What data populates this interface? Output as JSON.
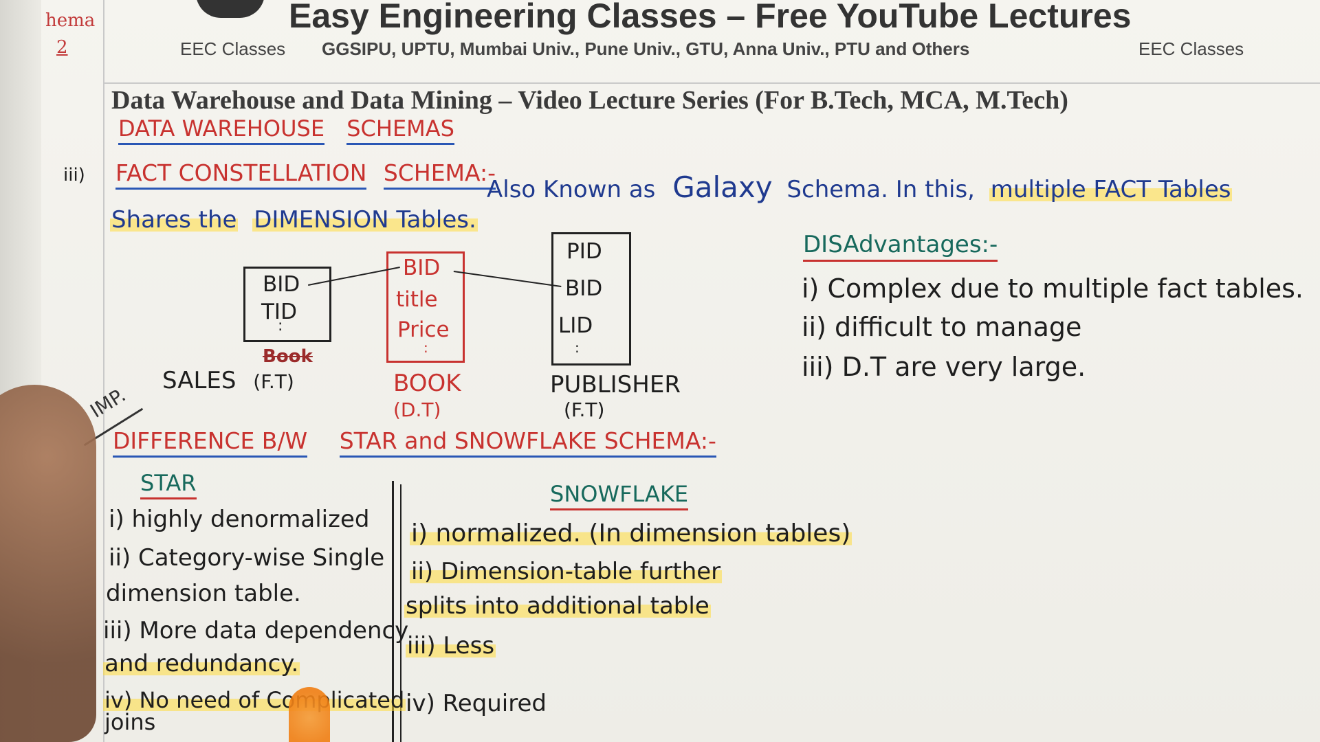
{
  "sidebar": {
    "label": "hema",
    "number": "2"
  },
  "header": {
    "title": "Easy Engineering Classes – Free YouTube Lectures",
    "left_tag": "EEC Classes",
    "universities": "GGSIPU, UPTU, Mumbai Univ., Pune Univ., GTU, Anna Univ., PTU and Others",
    "right_tag": "EEC Classes"
  },
  "series_title": "Data Warehouse and Data Mining – Video Lecture Series (For B.Tech, MCA, M.Tech)",
  "section_heading": {
    "word1": "DATA WAREHOUSE",
    "word2": "SCHEMAS"
  },
  "fact_constellation": {
    "roman": "iii)",
    "heading_a": "FACT CONSTELLATION",
    "heading_b": "SCHEMA:-",
    "line1_a": "Also Known as",
    "line1_b": "Galaxy",
    "line1_c": "Schema. In this,",
    "line1_d": "multiple FACT Tables",
    "line2_a": "Shares the",
    "line2_b": "DIMENSION Tables."
  },
  "diagram": {
    "sales_box": [
      "BID",
      "TID",
      ":"
    ],
    "sales_note": "Book",
    "sales_label": "SALES",
    "sales_type": "(F.T)",
    "book_box": [
      "BID",
      "title",
      "Price",
      ":"
    ],
    "book_label": "BOOK",
    "book_type": "(D.T)",
    "publisher_box": [
      "PID",
      "BID",
      "LID",
      ":"
    ],
    "publisher_label": "PUBLISHER",
    "publisher_type": "(F.T)"
  },
  "disadvantages": {
    "heading": "DISAdvantages:-",
    "items": [
      "i) Complex due to multiple fact tables.",
      "ii) difficult to manage",
      "iii) D.T are very large."
    ]
  },
  "imp": "IMP.",
  "difference": {
    "heading_a": "DIFFERENCE B/W",
    "heading_b": "STAR and SNOWFLAKE SCHEMA:-",
    "star_heading": "STAR",
    "snowflake_heading": "SNOWFLAKE",
    "star_items": [
      "i) highly denormalized",
      "ii) Category-wise Single",
      "dimension table.",
      "iii) More data dependency",
      "and redundancy.",
      "iv) No need of Complicated",
      "joins"
    ],
    "snowflake_items": [
      "i) normalized. (In dimension tables)",
      "ii) Dimension-table further",
      "splits into additional table",
      "iii) Less",
      "iv) Required"
    ]
  },
  "colors": {
    "red_ink": "#c8322f",
    "blue_ink": "#1f3a8f",
    "green_ink": "#17695c",
    "highlight": "#ffdc3c"
  }
}
